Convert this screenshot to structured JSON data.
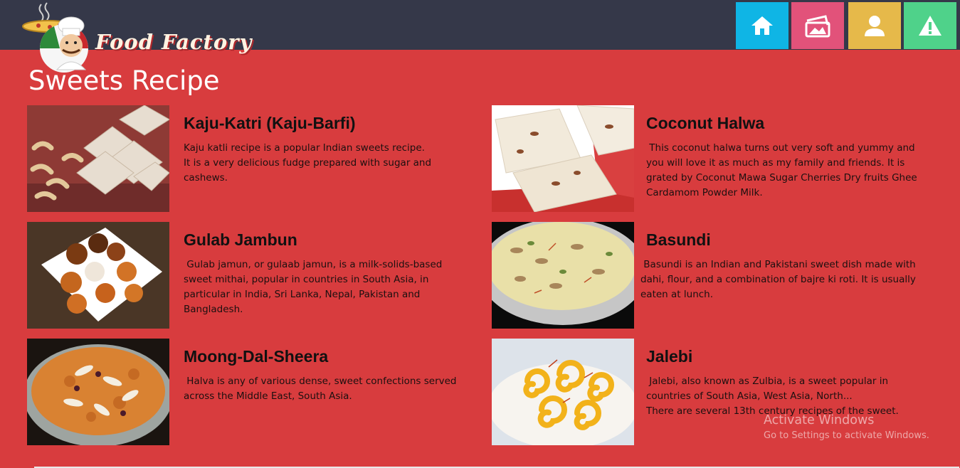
{
  "header": {
    "brand": "Food Factory",
    "logo_icon": "chef-pizza-mascot",
    "nav": [
      {
        "id": "home",
        "icon": "home-icon",
        "color": "#0fb5e5"
      },
      {
        "id": "gallery",
        "icon": "gallery-icon",
        "color": "#e2527a"
      },
      {
        "id": "user",
        "icon": "user-icon",
        "color": "#e6b94a"
      },
      {
        "id": "alert",
        "icon": "warning-icon",
        "color": "#4fd28a"
      }
    ]
  },
  "page": {
    "title": "Sweets Recipe",
    "background": "#d83c3e",
    "header_color": "#353849"
  },
  "recipes": [
    {
      "title": "Kaju-Katri (Kaju-Barfi)",
      "description": "Kaju katli recipe is a popular Indian sweets recipe.\nIt is a very delicious fudge prepared with sugar and cashews.",
      "image": "kaju-katli-photo"
    },
    {
      "title": "Coconut Halwa",
      "description": " This coconut halwa turns out very soft and yummy and you will love it as much as my family and friends. It is grated by Coconut Mawa Sugar Cherries Dry fruits Ghee Cardamom Powder Milk.",
      "image": "coconut-halwa-photo"
    },
    {
      "title": "Gulab Jambun",
      "description": " Gulab jamun, or gulaab jamun, is a milk-solids-based sweet mithai, popular in countries in South Asia, in particular in India, Sri Lanka, Nepal, Pakistan and Bangladesh.",
      "image": "gulab-jamun-photo"
    },
    {
      "title": "Basundi",
      "description": " Basundi is an Indian and Pakistani sweet dish made with   dahi, flour, and a combination of bajre ki roti. It is usually eaten at lunch.",
      "image": "basundi-photo"
    },
    {
      "title": "Moong-Dal-Sheera",
      "description": " Halva is any of various dense, sweet confections served across the Middle East, South Asia.",
      "image": "moong-dal-sheera-photo"
    },
    {
      "title": "Jalebi",
      "description": " Jalebi, also known as Zulbia, is a sweet popular in countries of South Asia, West Asia, North...\nThere are several 13th century recipes of the sweet.",
      "image": "jalebi-photo"
    }
  ],
  "watermark": {
    "title": "Activate Windows",
    "subtitle": "Go to Settings to activate Windows."
  }
}
